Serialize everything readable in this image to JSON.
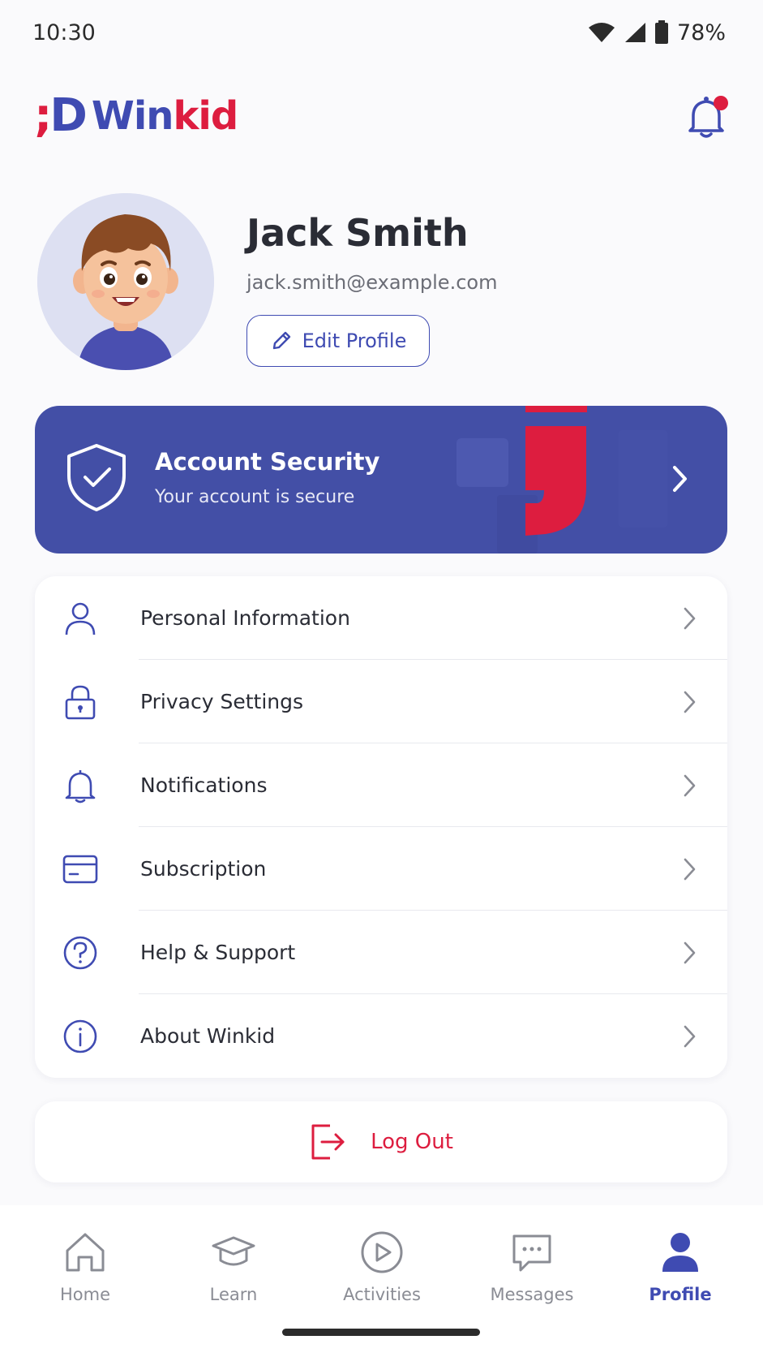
{
  "status_bar": {
    "time": "10:30",
    "battery": "78%"
  },
  "header": {
    "logo_mark_j": ";",
    "logo_mark_d": "D",
    "logo_word_a": "Win",
    "logo_word_b": "kid"
  },
  "profile": {
    "name": "Jack Smith",
    "email": "jack.smith@example.com",
    "edit_label": "Edit Profile"
  },
  "security": {
    "title": "Account Security",
    "subtitle": "Your account is secure"
  },
  "menu": {
    "items": [
      {
        "label": "Personal Information",
        "icon": "person-icon"
      },
      {
        "label": "Privacy Settings",
        "icon": "lock-icon"
      },
      {
        "label": "Notifications",
        "icon": "bell-icon"
      },
      {
        "label": "Subscription",
        "icon": "card-icon"
      },
      {
        "label": "Help & Support",
        "icon": "question-icon"
      },
      {
        "label": "About Winkid",
        "icon": "info-icon"
      }
    ]
  },
  "logout": {
    "label": "Log Out"
  },
  "nav": {
    "items": [
      {
        "label": "Home",
        "icon": "home-icon"
      },
      {
        "label": "Learn",
        "icon": "graduation-cap-icon"
      },
      {
        "label": "Activities",
        "icon": "play-icon"
      },
      {
        "label": "Messages",
        "icon": "chat-icon"
      },
      {
        "label": "Profile",
        "icon": "profile-icon"
      }
    ],
    "active": "Profile"
  },
  "colors": {
    "primary": "#434fa6",
    "accent": "#dd1d3f",
    "text": "#2a2c35",
    "muted": "#8a8c94"
  }
}
